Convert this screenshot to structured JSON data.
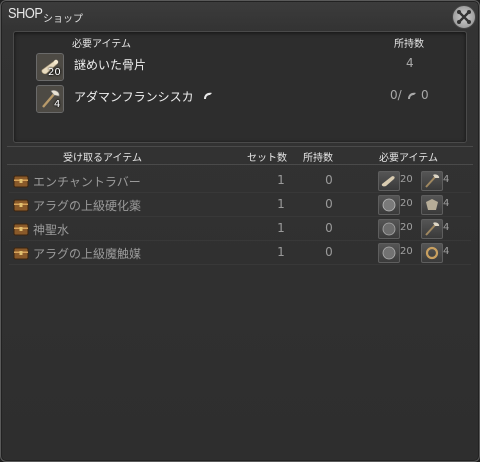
{
  "window": {
    "title": "SHOP",
    "subtitle": "ショップ"
  },
  "requirements": {
    "header_item": "必要アイテム",
    "header_owned": "所持数",
    "items": [
      {
        "name": "謎めいた骨片",
        "count": "20",
        "owned": "4",
        "icon": "bone-fragment-icon"
      },
      {
        "name": "アダマンフランシスカ",
        "count": "4",
        "owned": "0/",
        "owned_suffix": "0",
        "icon": "axe-icon"
      }
    ]
  },
  "shop_list": {
    "headers": {
      "item": "受け取るアイテム",
      "sets": "セット数",
      "owned": "所持数",
      "required": "必要アイテム"
    },
    "rows": [
      {
        "name": "エンチャントラバー",
        "sets": "1",
        "owned": "0",
        "req1_count": "20",
        "req1_icon": "bone-fragment-icon",
        "req2_count": "4",
        "req2_icon": "axe-icon"
      },
      {
        "name": "アラグの上級硬化薬",
        "sets": "1",
        "owned": "0",
        "req1_count": "20",
        "req1_icon": "orb-icon",
        "req2_count": "4",
        "req2_icon": "gauntlet-icon"
      },
      {
        "name": "神聖水",
        "sets": "1",
        "owned": "0",
        "req1_count": "20",
        "req1_icon": "orb-icon",
        "req2_count": "4",
        "req2_icon": "axe-icon"
      },
      {
        "name": "アラグの上級魔触媒",
        "sets": "1",
        "owned": "0",
        "req1_count": "20",
        "req1_icon": "orb-icon",
        "req2_count": "4",
        "req2_icon": "ring-icon"
      }
    ]
  },
  "colors": {
    "panel_bg": "#2e2e2e",
    "text_primary": "#f0f0f0",
    "text_dim": "#9a9a9a"
  }
}
